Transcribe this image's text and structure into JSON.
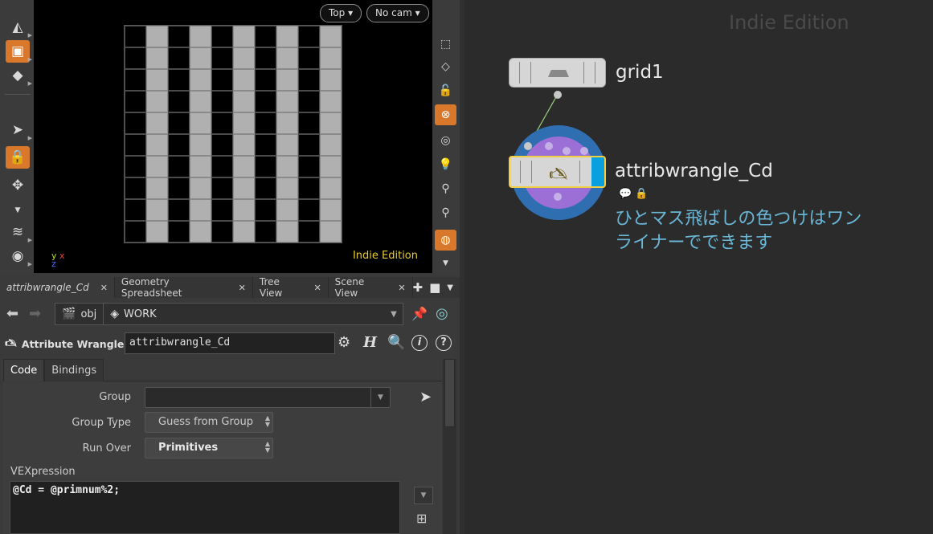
{
  "viewport": {
    "view_menu": "Top",
    "camera_menu": "No cam",
    "edition": "Indie Edition",
    "axis": {
      "y": "y",
      "x": "x",
      "z": "z"
    },
    "grid": {
      "rows": 10,
      "cols": 10,
      "pattern": "alternating-columns"
    }
  },
  "tabs": [
    {
      "label": "attribwrangle_Cd",
      "active": true
    },
    {
      "label": "Geometry Spreadsheet",
      "active": false
    },
    {
      "label": "Tree View",
      "active": false
    },
    {
      "label": "Scene View",
      "active": false
    }
  ],
  "path": {
    "root": "obj",
    "current": "WORK"
  },
  "parm_header": {
    "node_type": "Attribute Wrangle",
    "node_name": "attribwrangle_Cd"
  },
  "parm_tabs": {
    "code": "Code",
    "bindings": "Bindings"
  },
  "params": {
    "group_label": "Group",
    "group_value": "",
    "group_type_label": "Group Type",
    "group_type_value": "Guess from Group",
    "run_over_label": "Run Over",
    "run_over_value": "Primitives",
    "vexpression_label": "VEXpression",
    "vexpression_code": "@Cd = @primnum%2;"
  },
  "network": {
    "edition": "Indie Edition",
    "nodes": [
      {
        "name": "grid1"
      },
      {
        "name": "attribwrangle_Cd",
        "comment_line1": "ひとマス飛ばしの色つけはワン",
        "comment_line2": "ライナーでできます"
      }
    ]
  },
  "colors": {
    "accent_orange": "#d9772b",
    "edition_yellow": "#e8cc2c",
    "comment_blue": "#69b6d6",
    "node_select": "#f0d040",
    "node_display_flag": "#0aa0e0"
  }
}
